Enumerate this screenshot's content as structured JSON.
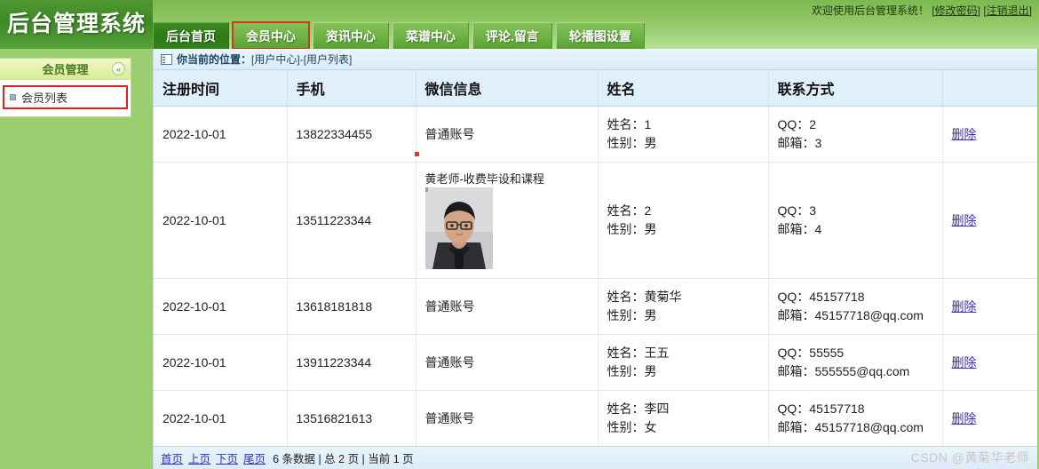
{
  "header": {
    "logo": "后台管理系统",
    "welcome_text": "欢迎使用后台管理系统！",
    "change_password": "[修改密码]",
    "logout": "[注销退出]"
  },
  "tabs": [
    {
      "label": "后台首页",
      "active": true,
      "marked": false
    },
    {
      "label": "会员中心",
      "active": false,
      "marked": true
    },
    {
      "label": "资讯中心",
      "active": false,
      "marked": false
    },
    {
      "label": "菜谱中心",
      "active": false,
      "marked": false
    },
    {
      "label": "评论.留言",
      "active": false,
      "marked": false
    },
    {
      "label": "轮播图设置",
      "active": false,
      "marked": false
    }
  ],
  "sidebar": {
    "title": "会员管理",
    "collapse_icon": "«",
    "items": [
      {
        "label": "会员列表",
        "marked": true
      }
    ]
  },
  "breadcrumb": {
    "label": "你当前的位置",
    "separator": "：",
    "path": "[用户中心]-[用户列表]"
  },
  "table": {
    "columns": [
      "注册时间",
      "手机",
      "微信信息",
      "姓名",
      "联系方式",
      ""
    ],
    "action_label": "删除",
    "rows": [
      {
        "register_time": "2022-10-01",
        "phone": "13822334455",
        "wechat": "普通账号",
        "has_photo": false,
        "photo_caption": "",
        "name_line": "姓名：1",
        "gender_line": "性别：男",
        "qq_line": "QQ：2",
        "email_line": "邮箱：3",
        "action": "删除"
      },
      {
        "register_time": "2022-10-01",
        "phone": "13511223344",
        "wechat": "",
        "has_photo": true,
        "photo_caption": "黄老师-收费毕设和课程",
        "name_line": "姓名：2",
        "gender_line": "性别：男",
        "qq_line": "QQ：3",
        "email_line": "邮箱：4",
        "action": "删除"
      },
      {
        "register_time": "2022-10-01",
        "phone": "13618181818",
        "wechat": "普通账号",
        "has_photo": false,
        "photo_caption": "",
        "name_line": "姓名：黄菊华",
        "gender_line": "性别：男",
        "qq_line": "QQ：45157718",
        "email_line": "邮箱：45157718@qq.com",
        "action": "删除"
      },
      {
        "register_time": "2022-10-01",
        "phone": "13911223344",
        "wechat": "普通账号",
        "has_photo": false,
        "photo_caption": "",
        "name_line": "姓名：王五",
        "gender_line": "性别：男",
        "qq_line": "QQ：55555",
        "email_line": "邮箱：555555@qq.com",
        "action": "删除"
      },
      {
        "register_time": "2022-10-01",
        "phone": "13516821613",
        "wechat": "普通账号",
        "has_photo": false,
        "photo_caption": "",
        "name_line": "姓名：李四",
        "gender_line": "性别：女",
        "qq_line": "QQ：45157718",
        "email_line": "邮箱：45157718@qq.com",
        "action": "删除"
      }
    ]
  },
  "pager": {
    "first": "首页",
    "prev": "上页",
    "next": "下页",
    "last": "尾页",
    "info": "6 条数据 | 总 2 页 | 当前 1 页"
  },
  "watermark": "CSDN @黄菊华老师",
  "colors": {
    "page_green": "#9bce70",
    "tab_active": "#2f7a17",
    "mark_red": "#e02020",
    "link_blue": "#3a2fc0",
    "header_blue": "#dff0fb"
  }
}
